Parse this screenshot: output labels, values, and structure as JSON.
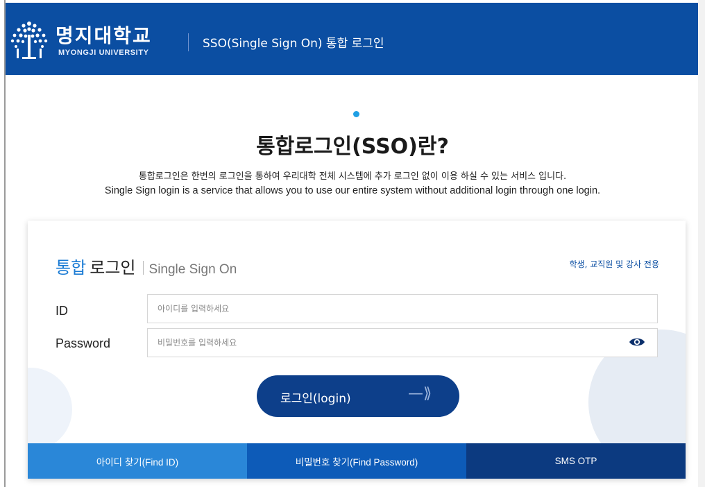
{
  "header": {
    "logo_ko": "명지대학교",
    "logo_en": "MYONGJI UNIVERSITY",
    "title": "SSO(Single Sign On) 통합 로그인"
  },
  "intro": {
    "title": "통합로그인(SSO)란?",
    "desc_ko": "통합로그인은 한번의 로그인을 통하여 우리대학 전체 시스템에 추가 로그인 없이 이용 하실 수 있는 서비스 입니다.",
    "desc_en": "Single Sign login is a service that allows you to use our entire system without additional login through one login."
  },
  "login_card": {
    "title_highlight": "통합",
    "title_main": "로그인",
    "title_en": "Single Sign On",
    "note": "학생, 교직원 및 강사 전용",
    "id_label": "ID",
    "id_placeholder": "아이디를 입력하세요",
    "id_value": "",
    "password_label": "Password",
    "password_placeholder": "비밀번호를 입력하세요",
    "password_value": "",
    "login_button": "로그인(login)",
    "login_arrow": "—⟫"
  },
  "bottom_links": {
    "find_id": "아이디 찾기(Find ID)",
    "find_password": "비밀번호 찾기(Find Password)",
    "sms_otp": "SMS OTP"
  },
  "colors": {
    "header_bg": "#0b4ea2",
    "accent_blue": "#1a7bd4",
    "login_button": "#0d3f8a"
  },
  "icons": {
    "logo": "tree-emblem-icon",
    "password_toggle": "eye-icon",
    "login_arrow": "arrow-right-icon"
  }
}
